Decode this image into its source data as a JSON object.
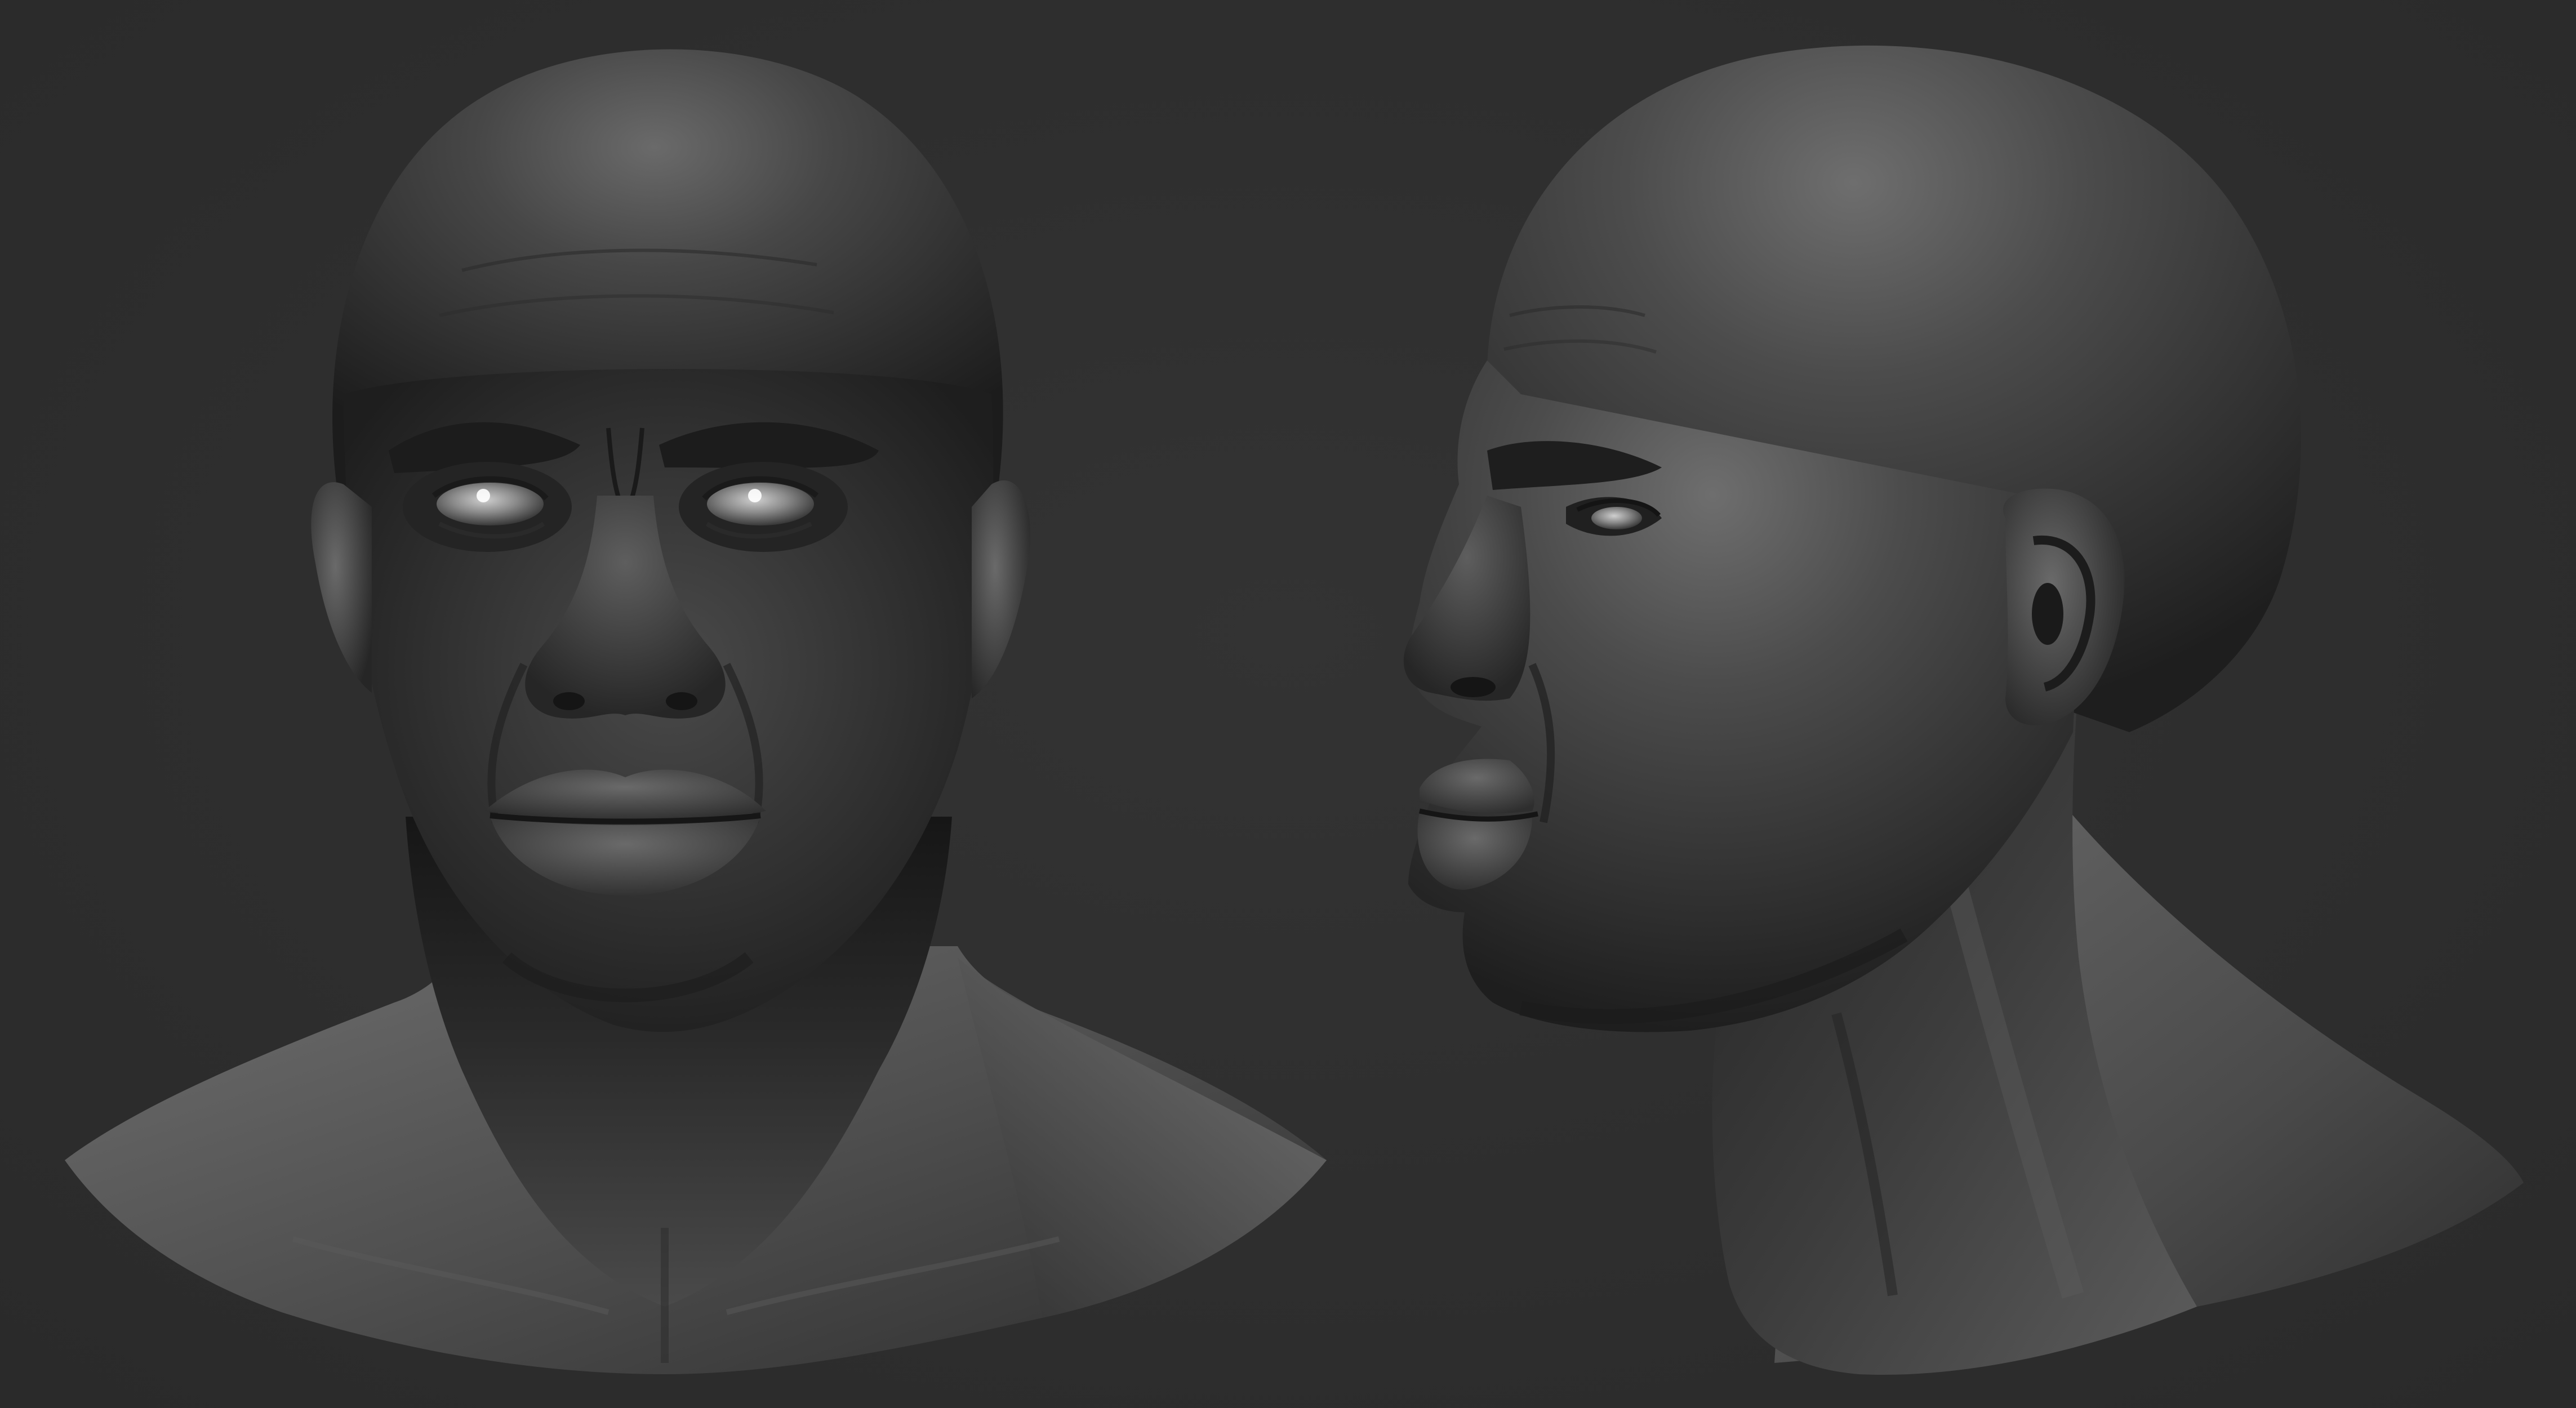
{
  "scene": {
    "background_color": "#2f2f2f",
    "material_color": "#3a3a3a",
    "views": [
      {
        "id": "front",
        "description_icon": "front-bust-sculpt"
      },
      {
        "id": "profile",
        "description_icon": "profile-bust-sculpt"
      }
    ]
  }
}
